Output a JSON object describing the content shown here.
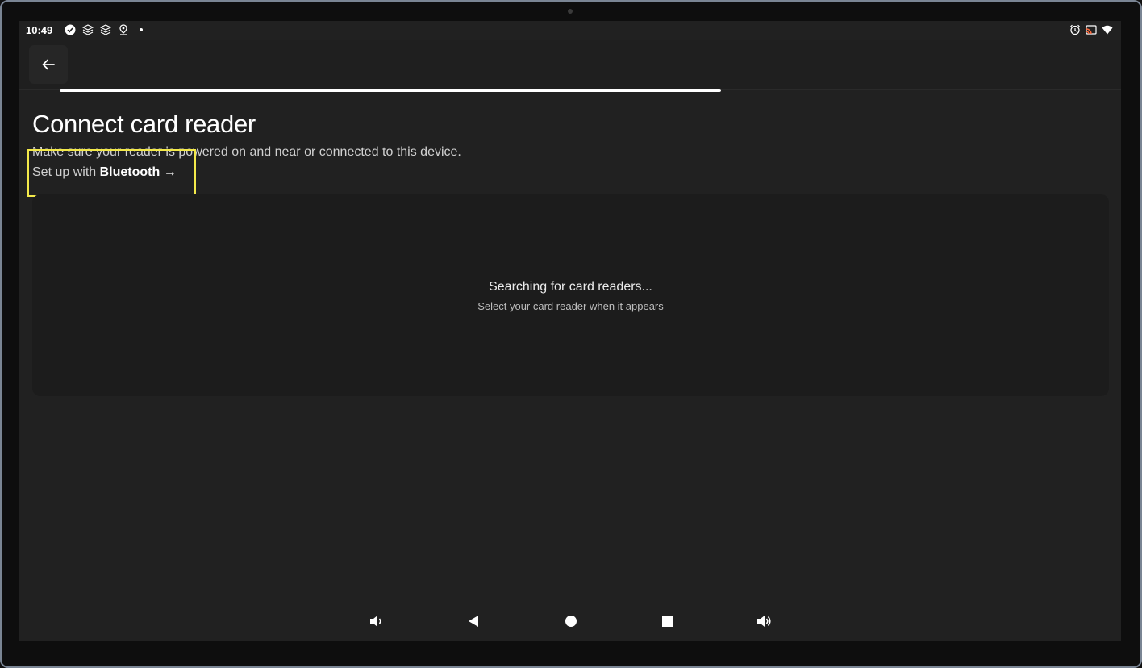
{
  "status_bar": {
    "time": "10:49",
    "left_icons": [
      "check-circle-icon",
      "layers-icon",
      "layers-icon",
      "location-pin-icon",
      "dot-icon"
    ],
    "right_icons": [
      "alarm-icon",
      "cast-icon",
      "wifi-icon"
    ]
  },
  "app_bar": {
    "back_icon": "arrow-left-icon",
    "progress": 0.6
  },
  "main": {
    "title": "Connect card reader",
    "subtitle": "Make sure your reader is powered on and near or connected to this device.",
    "setup_prefix": "Set up with",
    "setup_link": "Bluetooth",
    "setup_arrow": "→",
    "searching_title": "Searching for card readers...",
    "searching_subtitle": "Select your card reader when it appears"
  },
  "nav_bar": {
    "buttons": [
      "volume-down-icon",
      "back-triangle-icon",
      "home-circle-icon",
      "recents-square-icon",
      "volume-up-icon"
    ]
  },
  "colors": {
    "screen_bg": "#212121",
    "highlight": "#f3e94a",
    "text_primary": "#ffffff"
  }
}
